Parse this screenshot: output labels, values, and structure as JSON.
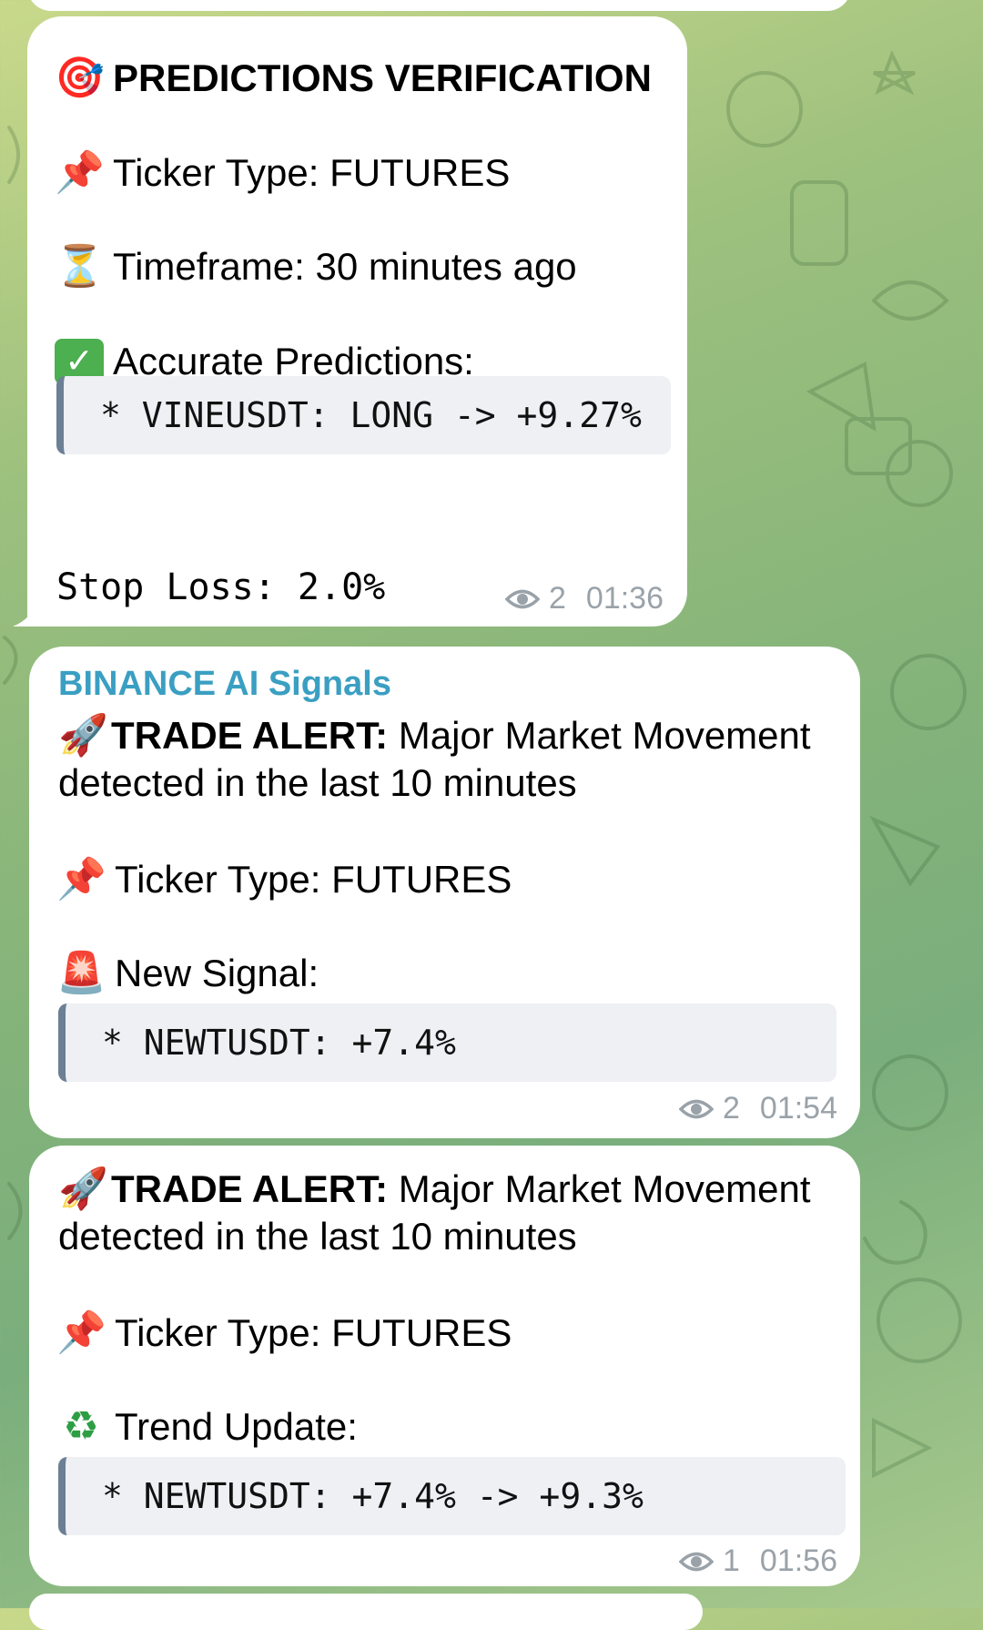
{
  "messages": [
    {
      "title_icon": "dart-target-icon",
      "title": "PREDICTIONS VERIFICATION",
      "ticker_icon": "pushpin-icon",
      "ticker": "Ticker Type: FUTURES",
      "timeframe_icon": "hourglass-icon",
      "timeframe": "Timeframe: 30 minutes ago",
      "accurate_icon": "check-mark-icon",
      "accurate": "Accurate Predictions:",
      "code": "* VINEUSDT: LONG -> +9.27%",
      "stop_loss": "Stop Loss: 2.0%",
      "views": "2",
      "time": "01:36"
    },
    {
      "sender": "BINANCE AI Signals",
      "alert_icon": "rocket-icon",
      "alert_bold": "TRADE ALERT:",
      "alert_text": " Major Market Movement detected in the last 10 minutes",
      "ticker_icon": "pushpin-icon",
      "ticker": "Ticker Type: FUTURES",
      "signal_icon": "siren-icon",
      "signal": "New Signal:",
      "code": "* NEWTUSDT: +7.4%",
      "views": "2",
      "time": "01:54"
    },
    {
      "alert_icon": "rocket-icon",
      "alert_bold": "TRADE ALERT:",
      "alert_text": " Major Market Movement detected in the last 10 minutes",
      "ticker_icon": "pushpin-icon",
      "ticker": "Ticker Type: FUTURES",
      "trend_icon": "recycle-icon",
      "trend": "Trend Update:",
      "code": "* NEWTUSDT: +7.4% -> +9.3%",
      "views": "1",
      "time": "01:56"
    }
  ]
}
